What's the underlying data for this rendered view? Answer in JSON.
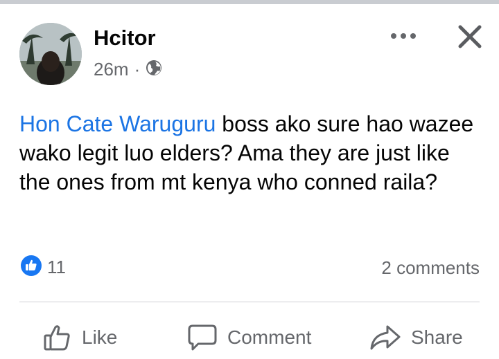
{
  "post": {
    "author": "Hcitor",
    "time": "26m",
    "separator": "·",
    "audience_icon": "globe-icon",
    "mention": "Hon Cate Waruguru",
    "text": " boss ako sure hao wazee wako legit luo elders? Ama  they are just like the ones from mt kenya who conned raila?"
  },
  "reactions": {
    "icon": "like-icon",
    "count": "11",
    "comments": "2 comments"
  },
  "actions": {
    "like": "Like",
    "comment": "Comment",
    "share": "Share"
  },
  "colors": {
    "mention": "#1b74e4",
    "secondary_text": "#65676b",
    "like_blue": "#1877f2"
  }
}
